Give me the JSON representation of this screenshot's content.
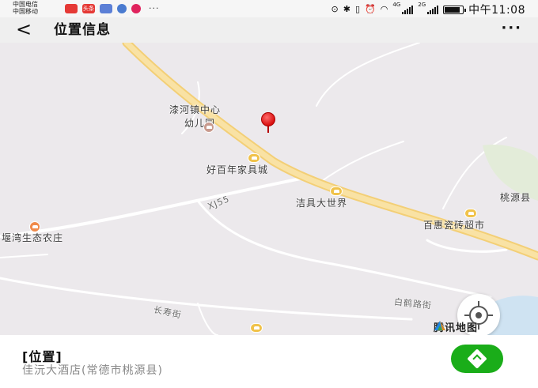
{
  "status_bar": {
    "carrier_1": "中国电信",
    "carrier_2": "中国移动",
    "apps": [
      {
        "icon": "app-red-icon",
        "label": "",
        "color": "#e53935"
      },
      {
        "icon": "toutiao-icon",
        "label": "头条",
        "color": "#e53935"
      },
      {
        "icon": "app-blue-icon",
        "label": "",
        "color": "#5b7fd6"
      },
      {
        "icon": "app-music-icon",
        "label": "",
        "color": "#4a7bd0"
      },
      {
        "icon": "app-video-icon",
        "label": "",
        "color": "#e0245e"
      }
    ],
    "more": "···",
    "net_1": "4G",
    "net_2": "2G",
    "time": "中午11:08"
  },
  "title_bar": {
    "back_glyph": "<",
    "title": "位置信息",
    "more_glyph": "···"
  },
  "map": {
    "labels": {
      "poi_kindergarten_1": "漆河镇中心",
      "poi_kindergarten_2": "幼儿园",
      "poi_furniture": "好百年家具城",
      "road_xj55": "XJ55",
      "poi_jieju": "洁具大世界",
      "poi_taoyuan": "桃源县",
      "poi_tiles": "百惠瓷砖超市",
      "poi_farm": "堰湾生态农庄",
      "road_baihe": "白鹤路街",
      "road_changshou": "长寿街"
    },
    "brand": "腾讯地图",
    "colors": {
      "background": "#ece9ec",
      "main_road": "#f8d880",
      "minor_road": "#ffffff",
      "pin": "#d90f0f"
    }
  },
  "place": {
    "name": "[位置]",
    "address": "佳沅大酒店(常德市桃源县)"
  },
  "nav_button": {
    "icon": "navigation-icon",
    "color": "#1aad19"
  }
}
